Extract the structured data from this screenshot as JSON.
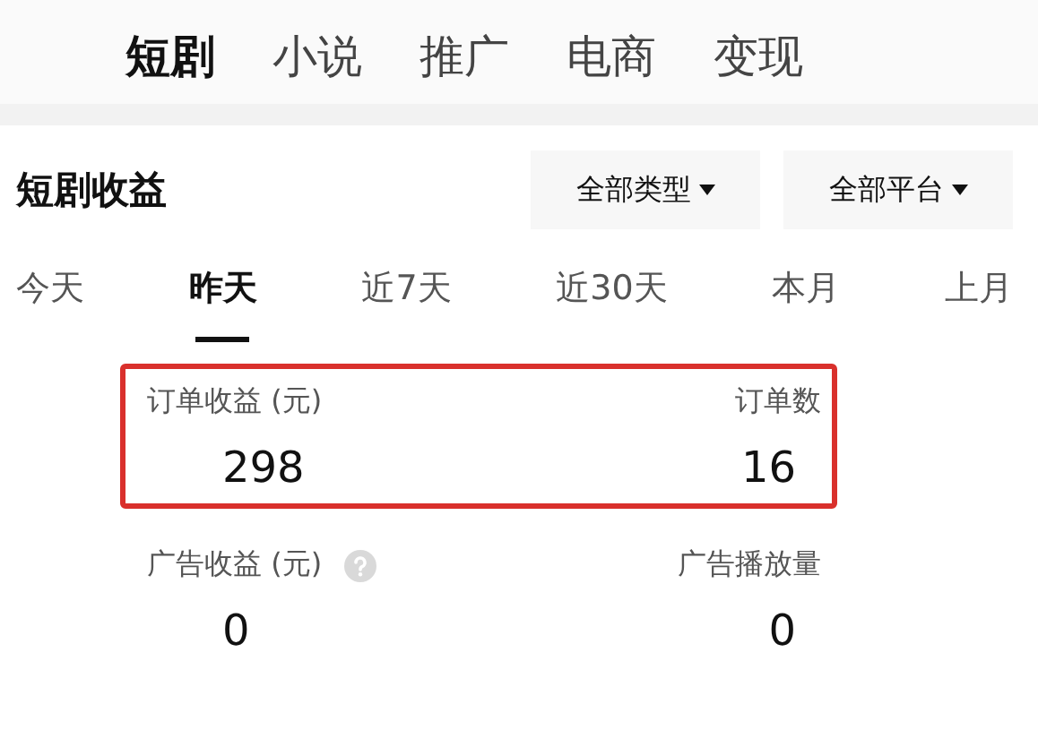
{
  "top_tabs": [
    {
      "label": "短剧",
      "selected": true
    },
    {
      "label": "小说",
      "selected": false
    },
    {
      "label": "推广",
      "selected": false
    },
    {
      "label": "电商",
      "selected": false
    },
    {
      "label": "变现",
      "selected": false
    }
  ],
  "section": {
    "title": "短剧收益",
    "filters": [
      {
        "label": "全部类型"
      },
      {
        "label": "全部平台"
      }
    ]
  },
  "periods": [
    {
      "label": "今天",
      "selected": false
    },
    {
      "label": "昨天",
      "selected": true
    },
    {
      "label": "近7天",
      "selected": false
    },
    {
      "label": "近30天",
      "selected": false
    },
    {
      "label": "本月",
      "selected": false
    },
    {
      "label": "上月",
      "selected": false
    }
  ],
  "metric_rows": [
    {
      "highlighted": true,
      "items": [
        {
          "label": "订单收益 (元)",
          "value": "298",
          "help": false
        },
        {
          "label": "订单数",
          "value": "16",
          "help": false
        }
      ]
    },
    {
      "highlighted": false,
      "items": [
        {
          "label": "广告收益 (元)",
          "value": "0",
          "help": true
        },
        {
          "label": "广告播放量",
          "value": "0",
          "help": false
        }
      ]
    }
  ]
}
